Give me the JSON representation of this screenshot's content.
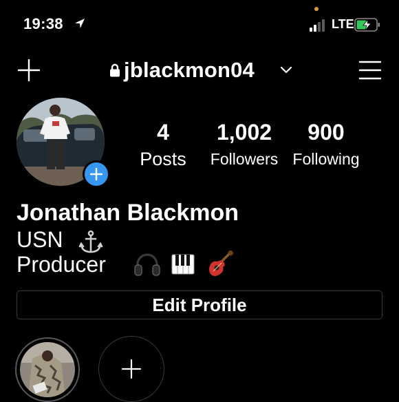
{
  "status_bar": {
    "time": "19:38",
    "network": "LTE"
  },
  "header": {
    "username": "jblackmon04"
  },
  "stats": {
    "posts": {
      "value": "4",
      "label": "Posts"
    },
    "followers": {
      "value": "1,002",
      "label": "Followers"
    },
    "following": {
      "value": "900",
      "label": "Following"
    }
  },
  "bio": {
    "name": "Jonathan Blackmon",
    "line1": "USN",
    "line2": "Producer"
  },
  "edit_profile_label": "Edit Profile",
  "colors": {
    "background": "#000000",
    "text": "#ffffff",
    "accent_blue": "#3797f0",
    "battery_green": "#34c759",
    "indicator_orange": "#d99a3b"
  },
  "icons": [
    "location-arrow-icon",
    "signal-icon",
    "battery-charging-icon",
    "plus-icon",
    "lock-icon",
    "chevron-down-icon",
    "menu-icon",
    "anchor-emoji",
    "headphones-emoji",
    "piano-emoji",
    "guitar-emoji"
  ]
}
